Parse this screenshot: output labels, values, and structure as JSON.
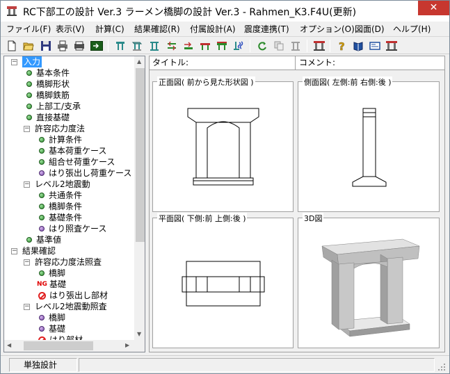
{
  "window": {
    "title": "RC下部工の設計 Ver.3 ラーメン橋脚の設計 Ver.3 - Rahmen_K3.F4U(更新)",
    "close_label": "✕"
  },
  "menu": [
    {
      "label": "ファイル(F)"
    },
    {
      "label": "表示(V)"
    },
    {
      "label": "計算(C)"
    },
    {
      "label": "結果確認(R)"
    },
    {
      "label": "付属設計(A)"
    },
    {
      "label": "震度連携(T)"
    },
    {
      "label": "オプション(O)"
    },
    {
      "label": "図面(D)"
    },
    {
      "label": "ヘルプ(H)"
    }
  ],
  "toolbar": {
    "buttons": [
      {
        "icon": "new-file-icon"
      },
      {
        "icon": "open-folder-icon"
      },
      {
        "icon": "save-icon"
      },
      {
        "icon": "print-icon"
      },
      {
        "icon": "print-preview-icon"
      },
      {
        "icon": "export-icon"
      },
      {
        "icon": "pier-frame-icon"
      },
      {
        "icon": "pier-3d-icon"
      },
      {
        "icon": "pier-column-icon"
      },
      {
        "icon": "rebar-icon"
      },
      {
        "icon": "load-icon"
      },
      {
        "icon": "beam-icon"
      },
      {
        "icon": "beam-2-icon"
      },
      {
        "icon": "seismic-icon"
      },
      {
        "icon": "refresh-icon"
      },
      {
        "icon": "copy-icon"
      },
      {
        "icon": "foundation-icon"
      },
      {
        "icon": "report-icon"
      },
      {
        "icon": "help-icon"
      },
      {
        "icon": "book-icon"
      },
      {
        "icon": "drawing-icon"
      },
      {
        "icon": "app-link-icon"
      }
    ]
  },
  "tree": {
    "items": [
      {
        "label": "入力",
        "level": 0,
        "expander": "−",
        "icon": "none",
        "selected": true
      },
      {
        "label": "基本条件",
        "level": 1,
        "icon": "green"
      },
      {
        "label": "橋脚形状",
        "level": 1,
        "icon": "green"
      },
      {
        "label": "橋脚鉄筋",
        "level": 1,
        "icon": "green"
      },
      {
        "label": "上部工/支承",
        "level": 1,
        "icon": "green"
      },
      {
        "label": "直接基礎",
        "level": 1,
        "icon": "green"
      },
      {
        "label": "許容応力度法",
        "level": 1,
        "expander": "−",
        "icon": "none"
      },
      {
        "label": "計算条件",
        "level": 2,
        "icon": "green"
      },
      {
        "label": "基本荷重ケース",
        "level": 2,
        "icon": "green"
      },
      {
        "label": "組合せ荷重ケース",
        "level": 2,
        "icon": "green"
      },
      {
        "label": "はり張出し荷重ケース",
        "level": 2,
        "icon": "purple"
      },
      {
        "label": "レベル2地震動",
        "level": 1,
        "expander": "−",
        "icon": "none"
      },
      {
        "label": "共通条件",
        "level": 2,
        "icon": "green"
      },
      {
        "label": "橋脚条件",
        "level": 2,
        "icon": "green"
      },
      {
        "label": "基礎条件",
        "level": 2,
        "icon": "green"
      },
      {
        "label": "はり照査ケース",
        "level": 2,
        "icon": "purple"
      },
      {
        "label": "基準値",
        "level": 1,
        "icon": "green"
      },
      {
        "label": "結果確認",
        "level": 0,
        "expander": "−",
        "icon": "none"
      },
      {
        "label": "許容応力度法照査",
        "level": 1,
        "expander": "−",
        "icon": "none"
      },
      {
        "label": "橋脚",
        "level": 2,
        "icon": "green"
      },
      {
        "label": "基礎",
        "level": 2,
        "icon": "ng",
        "badge": "NG"
      },
      {
        "label": "はり張出し部材",
        "level": 2,
        "icon": "no"
      },
      {
        "label": "レベル2地震動照査",
        "level": 1,
        "expander": "−",
        "icon": "none"
      },
      {
        "label": "橋脚",
        "level": 2,
        "icon": "purple"
      },
      {
        "label": "基礎",
        "level": 2,
        "icon": "purple"
      },
      {
        "label": "はり部材",
        "level": 2,
        "icon": "no"
      }
    ]
  },
  "info": {
    "title_label": "タイトル:",
    "comment_label": "コメント:"
  },
  "views": {
    "front_caption": "正面図( 前から見た形状図 )",
    "side_caption": "側面図( 左側:前 右側:後 )",
    "plan_caption": "平面図( 下側:前 上側:後 )",
    "three_d_caption": "3D図"
  },
  "status": {
    "mode_label": "単独設計"
  },
  "colors": {
    "selection": "#3399ff",
    "close": "#c7372f",
    "ok_dot": "#2d8a2d",
    "pending_dot": "#7a4aa8",
    "ng": "#e00000"
  }
}
